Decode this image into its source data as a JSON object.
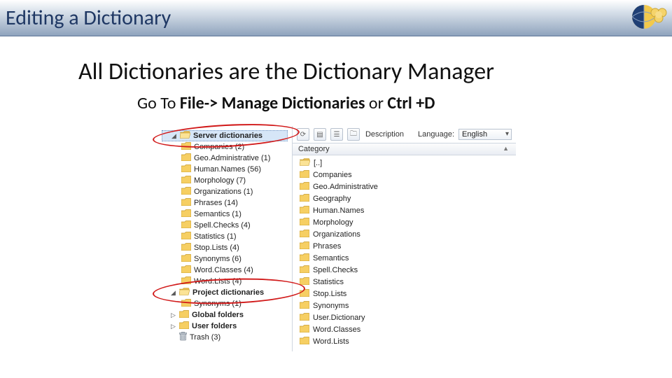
{
  "slide": {
    "title": "Editing a Dictionary",
    "subtitle": "All Dictionaries are the Dictionary Manager",
    "instruction_prefix": "Go To ",
    "instruction_bold1": "File-> Manage Dictionaries",
    "instruction_mid": " or ",
    "instruction_bold2": "Ctrl +D"
  },
  "toolbar": {
    "lang_label": "Language:",
    "lang_value": "English",
    "desc_label": "Description"
  },
  "column_header": "Category",
  "tree": {
    "groups": [
      {
        "name": "server",
        "label": "Server dictionaries",
        "bold": true,
        "expanded": true,
        "selected": true,
        "children": [
          {
            "label": "Companies (2)"
          },
          {
            "label": "Geo.Administrative (1)"
          },
          {
            "label": "Human.Names (56)"
          },
          {
            "label": "Morphology (7)"
          },
          {
            "label": "Organizations (1)"
          },
          {
            "label": "Phrases (14)"
          },
          {
            "label": "Semantics (1)"
          },
          {
            "label": "Spell.Checks (4)"
          },
          {
            "label": "Statistics (1)"
          },
          {
            "label": "Stop.Lists (4)"
          },
          {
            "label": "Synonyms (6)"
          },
          {
            "label": "Word.Classes (4)"
          },
          {
            "label": "Word.Lists (4)"
          }
        ]
      },
      {
        "name": "project",
        "label": "Project dictionaries",
        "bold": true,
        "expanded": true,
        "children": [
          {
            "label": "Synonyms (1)"
          }
        ]
      },
      {
        "name": "global",
        "label": "Global folders",
        "bold": true,
        "expanded": false,
        "children": []
      },
      {
        "name": "user",
        "label": "User folders",
        "bold": true,
        "expanded": false,
        "children": []
      },
      {
        "name": "trash",
        "label": "Trash (3)",
        "bold": false,
        "expanded": false,
        "icon": "trash",
        "children": []
      }
    ]
  },
  "categories": [
    {
      "label": "[..]",
      "up": true
    },
    {
      "label": "Companies"
    },
    {
      "label": "Geo.Administrative"
    },
    {
      "label": "Geography"
    },
    {
      "label": "Human.Names"
    },
    {
      "label": "Morphology"
    },
    {
      "label": "Organizations"
    },
    {
      "label": "Phrases"
    },
    {
      "label": "Semantics"
    },
    {
      "label": "Spell.Checks"
    },
    {
      "label": "Statistics"
    },
    {
      "label": "Stop.Lists"
    },
    {
      "label": "Synonyms"
    },
    {
      "label": "User.Dictionary"
    },
    {
      "label": "Word.Classes"
    },
    {
      "label": "Word.Lists"
    }
  ]
}
